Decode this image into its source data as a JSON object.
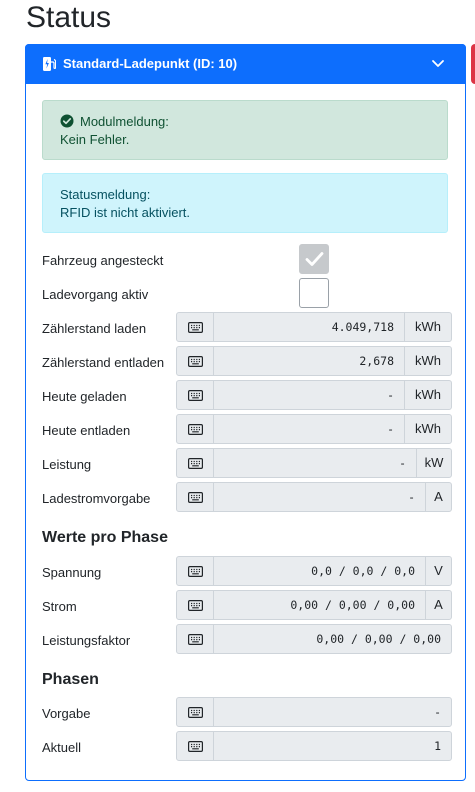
{
  "page": {
    "title": "Status"
  },
  "card": {
    "header_title": "Standard-Ladepunkt (ID: 10)",
    "module_alert": {
      "title": "Modulmeldung:",
      "text": "Kein Fehler."
    },
    "status_alert": {
      "title": "Statusmeldung:",
      "text": "RFID ist nicht aktiviert."
    },
    "checks": [
      {
        "label": "Fahrzeug angesteckt",
        "checked": true
      },
      {
        "label": "Ladevorgang aktiv",
        "checked": false
      }
    ],
    "values": [
      {
        "label": "Zählerstand laden",
        "value": "4.049,718",
        "unit": "kWh"
      },
      {
        "label": "Zählerstand entladen",
        "value": "2,678",
        "unit": "kWh"
      },
      {
        "label": "Heute geladen",
        "value": "-",
        "unit": "kWh"
      },
      {
        "label": "Heute entladen",
        "value": "-",
        "unit": "kWh"
      },
      {
        "label": "Leistung",
        "value": "-",
        "unit": "kW"
      },
      {
        "label": "Ladestromvorgabe",
        "value": "-",
        "unit": "A"
      }
    ],
    "phase_section": {
      "title": "Werte pro Phase",
      "rows": [
        {
          "label": "Spannung",
          "value": "0,0 / 0,0 / 0,0",
          "unit": "V"
        },
        {
          "label": "Strom",
          "value": "0,00 / 0,00 / 0,00",
          "unit": "A"
        },
        {
          "label": "Leistungsfaktor",
          "value": "0,00 / 0,00 / 0,00"
        }
      ]
    },
    "phasen_section": {
      "title": "Phasen",
      "rows": [
        {
          "label": "Vorgabe",
          "value": "-"
        },
        {
          "label": "Aktuell",
          "value": "1"
        }
      ]
    }
  },
  "colors": {
    "primary": "#0d6efd",
    "success_bg": "#d1e7dd",
    "info_bg": "#cff4fc",
    "danger": "#dc3545"
  },
  "icons": {
    "header": "charging-station-icon",
    "collapse": "chevron-down-icon",
    "alert": "check-circle-icon",
    "input": "keyboard-icon"
  }
}
